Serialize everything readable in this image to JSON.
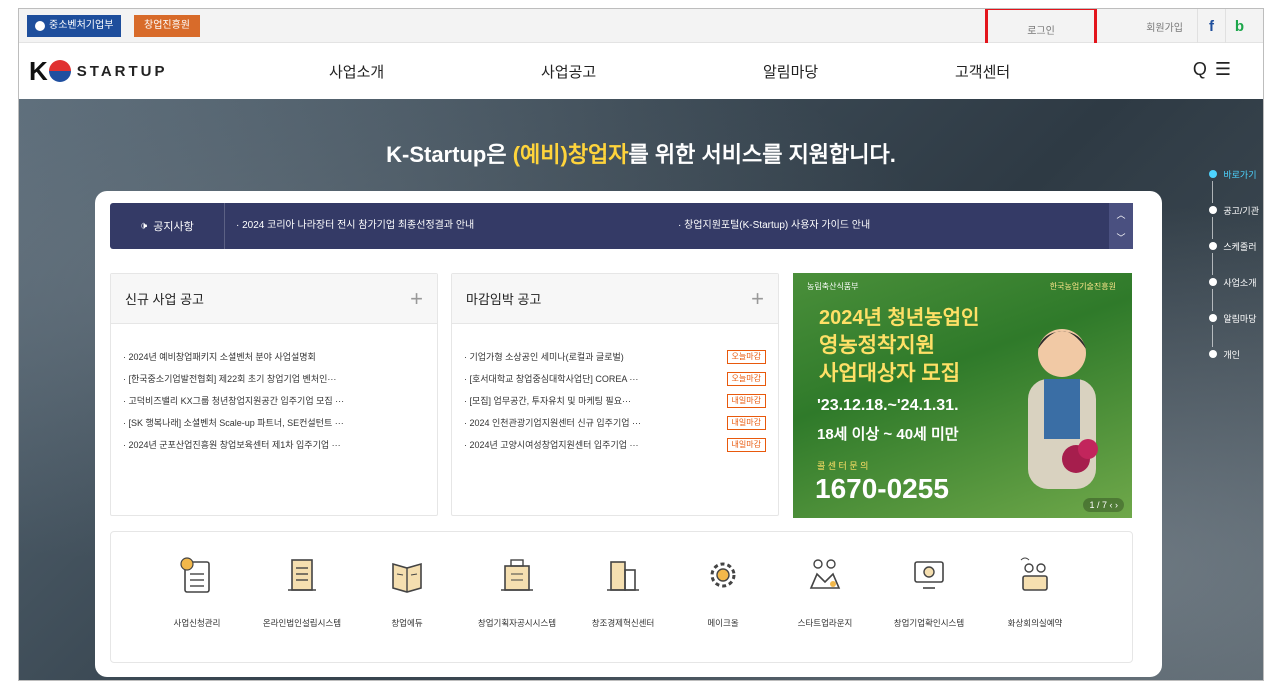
{
  "util": {
    "gov_label": "중소벤처기업부",
    "kised_label": "창업진흥원",
    "login": "로그인",
    "join": "회원가입",
    "facebook": "f",
    "blog": "b"
  },
  "gnb": {
    "logo_k": "K",
    "logo_word": "STARTUP",
    "menu": [
      "사업소개",
      "사업공고",
      "알림마당",
      "고객센터"
    ],
    "search_icon": "Q",
    "menu_icon": "☰"
  },
  "hero": {
    "headline_pre": "K-Startup은 ",
    "headline_hl": "(예비)창업자",
    "headline_post": "를 위한 서비스를 지원합니다."
  },
  "side_nav": [
    "바로가기",
    "공고/기관",
    "스케줄러",
    "사업소개",
    "알림마당",
    "개인"
  ],
  "notice": {
    "label": "공지사항",
    "items": [
      "· 2024 코리아 나라장터 전시 참가기업 최종선정결과 안내",
      "· 창업지원포털(K-Startup) 사용자 가이드 안내"
    ]
  },
  "new_board": {
    "title": "신규 사업 공고",
    "plus": "+",
    "items": [
      "· 2024년 예비창업패키지 소셜벤처 분야 사업설명회",
      "· [한국중소기업발전협회] 제22회 초기 창업기업 벤처인···",
      "· 고덕비즈밸리 KX그룹 청년창업지원공간 입주기업 모집 ···",
      "· [SK 행복나래] 소셜벤처 Scale-up 파트너, SE컨설턴트 ···",
      "· 2024년 군포산업진흥원 창업보육센터 제1차 입주기업 ···"
    ]
  },
  "deadline_board": {
    "title": "마감임박 공고",
    "plus": "+",
    "items": [
      {
        "text": "· 기업가형 소상공인 세미나(로컬과 글로벌)",
        "tag": "오늘마감"
      },
      {
        "text": "· [호서대학교 창업중심대학사업단] COREA ···",
        "tag": "오늘마감"
      },
      {
        "text": "· [모집] 업무공간, 투자유치 및 마케팅 필요···",
        "tag": "내일마감"
      },
      {
        "text": "· 2024 인천관광기업지원센터 신규 입주기업 ···",
        "tag": "내일마감"
      },
      {
        "text": "· 2024년 고양시여성창업지원센터 입주기업 ···",
        "tag": "내일마감"
      }
    ]
  },
  "banner": {
    "org": "농림축산식품부",
    "org2": "한국농업기술진흥원",
    "line1": "2024년 청년농업인",
    "line2": "영농정착지원",
    "line3": "사업대상자 모집",
    "date": "'23.12.18.~'24.1.31.",
    "age": "18세 이상 ~ 40세 미만",
    "call_label": "콜 센 터 문 의",
    "phone": "1670-0255",
    "ctrl": "1 / 7  ‹  ›"
  },
  "quick_links": [
    "사업신청관리",
    "온라인법인설립시스템",
    "창업에듀",
    "창업기획자공시시스템",
    "창조경제혁신센터",
    "메이크올",
    "스타트업라운지",
    "창업기업확인시스템",
    "화상회의실예약"
  ]
}
